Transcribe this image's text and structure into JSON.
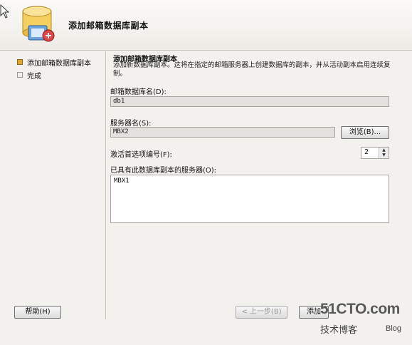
{
  "header": {
    "title": "添加邮箱数据库副本",
    "icon": "database-copy-icon"
  },
  "steps": [
    {
      "label": "添加邮箱数据库副本",
      "active": true
    },
    {
      "label": "完成",
      "active": false
    }
  ],
  "section": {
    "title": "添加邮箱数据库副本",
    "description": "添加新数据库副本。这将在指定的邮箱服务器上创建数据库的副本，并从活动副本启用连续复制。"
  },
  "fields": {
    "db_name_label": "邮箱数据库名(D):",
    "db_name_value": "db1",
    "server_label": "服务器名(S):",
    "server_value": "MBX2",
    "browse_label": "浏览(B)...",
    "activation_label": "激活首选项编号(F):",
    "activation_value": "2",
    "existing_label": "已具有此数据库副本的服务器(O):",
    "existing_servers": "MBX1"
  },
  "footer": {
    "help_label": "帮助(H)",
    "back_label": "< 上一步(B)",
    "add_label": "添加"
  },
  "watermark": {
    "site": "51CTO.com",
    "line1": "技术博客",
    "line2": "Blog"
  }
}
